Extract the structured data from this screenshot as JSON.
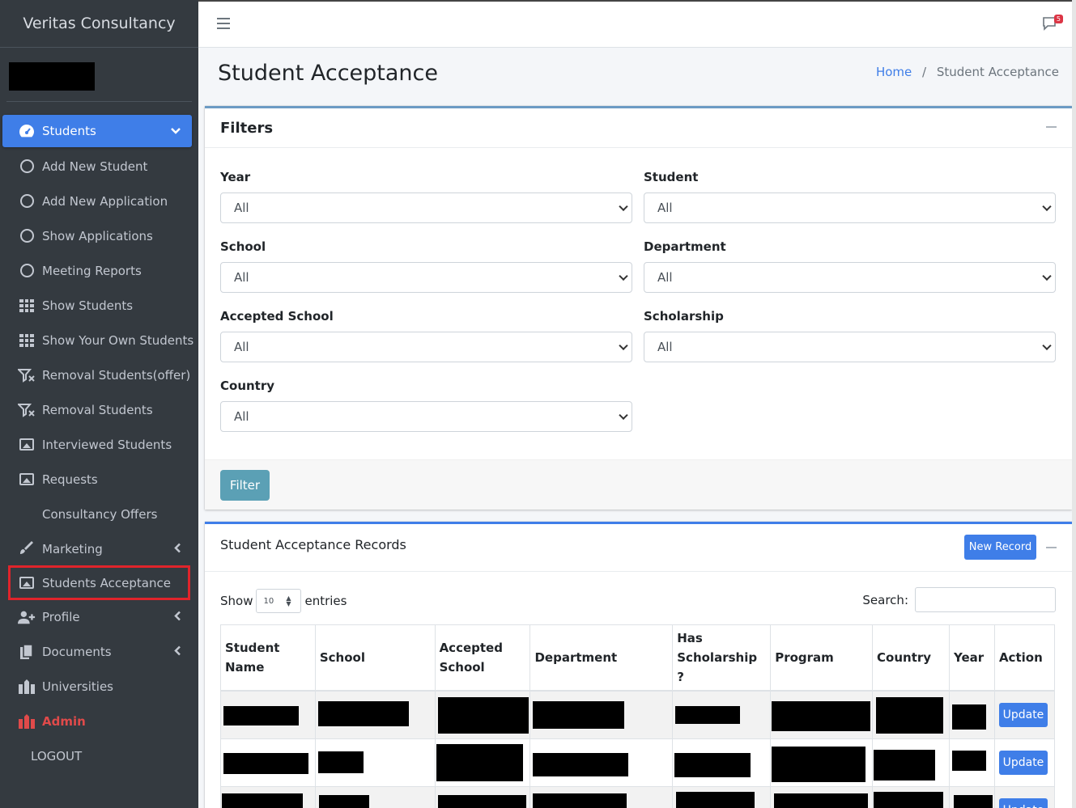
{
  "brand": "Veritas Consultancy",
  "nav": [
    {
      "label": "Students",
      "icon": "dashboard-icon",
      "active": true,
      "arrow": "down"
    },
    {
      "label": "Add New Student",
      "icon": "circle-icon"
    },
    {
      "label": "Add New Application",
      "icon": "circle-icon"
    },
    {
      "label": "Show Applications",
      "icon": "circle-icon"
    },
    {
      "label": "Meeting Reports",
      "icon": "circle-icon"
    },
    {
      "label": "Show Students",
      "icon": "grid-icon"
    },
    {
      "label": "Show Your Own Students",
      "icon": "grid-icon"
    },
    {
      "label": "Removal Students(offer)",
      "icon": "remove-filter-icon"
    },
    {
      "label": "Removal Students",
      "icon": "remove-filter-icon"
    },
    {
      "label": "Interviewed Students",
      "icon": "image-icon"
    },
    {
      "label": "Requests",
      "icon": "image-icon"
    },
    {
      "label": "Consultancy Offers",
      "icon": ""
    },
    {
      "label": "Marketing",
      "icon": "brush-icon",
      "arrow": "left"
    },
    {
      "label": "Students Acceptance",
      "icon": "image-icon",
      "highlighted": true
    },
    {
      "label": "Profile",
      "icon": "user-plus-icon",
      "arrow": "left"
    },
    {
      "label": "Documents",
      "icon": "copy-icon",
      "arrow": "left"
    },
    {
      "label": "Universities",
      "icon": "university-icon"
    },
    {
      "label": "Admin",
      "icon": "admin-icon"
    },
    {
      "label": "LOGOUT",
      "icon": ""
    }
  ],
  "topbar": {
    "notification_count": "5"
  },
  "page": {
    "title": "Student Acceptance",
    "breadcrumb_home": "Home",
    "breadcrumb_current": "Student Acceptance"
  },
  "filters": {
    "title": "Filters",
    "fields": [
      {
        "label": "Year",
        "value": "All"
      },
      {
        "label": "Student",
        "value": "All"
      },
      {
        "label": "School",
        "value": "All"
      },
      {
        "label": "Department",
        "value": "All"
      },
      {
        "label": "Accepted School",
        "value": "All"
      },
      {
        "label": "Scholarship",
        "value": "All"
      },
      {
        "label": "Country",
        "value": "All"
      }
    ],
    "button": "Filter"
  },
  "records": {
    "title": "Student Acceptance Records",
    "new_button": "New Record",
    "show_label": "Show",
    "entries_value": "10",
    "entries_label": "entries",
    "search_label": "Search:",
    "columns": [
      "Student Name",
      "School",
      "Accepted School",
      "Department",
      "Has Scholarship ?",
      "Program",
      "Country",
      "Year",
      "Action"
    ],
    "action_label": "Update"
  },
  "colors": {
    "sidebar": "#343a40",
    "primary": "#3f7ee8",
    "filter_button": "#5ba0b5",
    "admin": "#e04a4a",
    "highlight_box": "#e0242b"
  }
}
